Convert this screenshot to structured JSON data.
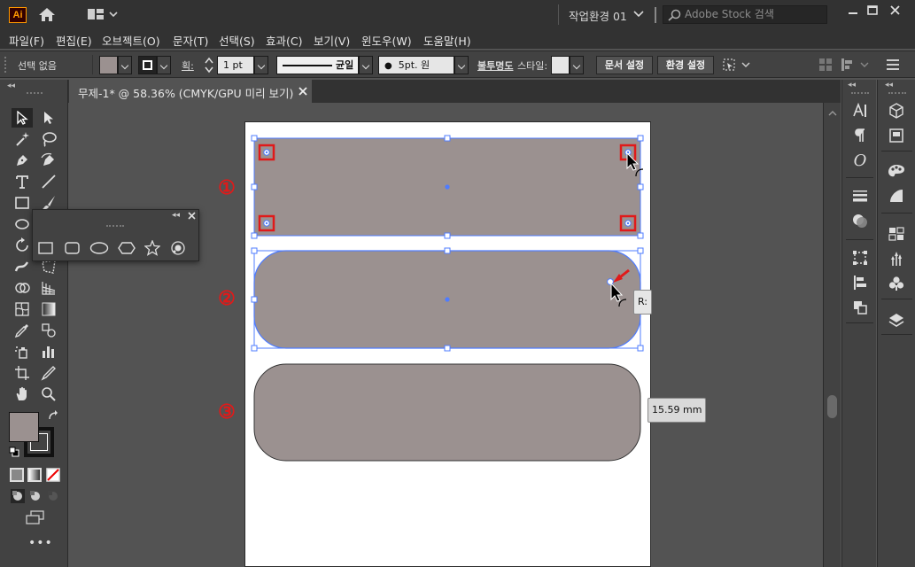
{
  "app": {
    "logo_text": "Ai",
    "workspace": "작업환경 01",
    "search_placeholder": "Adobe Stock 검색"
  },
  "menu": [
    "파일(F)",
    "편집(E)",
    "오브젝트(O)",
    "문자(T)",
    "선택(S)",
    "효과(C)",
    "보기(V)",
    "윈도우(W)",
    "도움말(H)"
  ],
  "control": {
    "selection_status": "선택 없음",
    "stroke_weight_label": "획:",
    "stroke_weight_value": "1 pt",
    "profile_label": "균일",
    "brush_label": "5pt. 원",
    "opacity_label": "불투명도",
    "style_label": "스타일:",
    "doc_setup_button": "문서 설정",
    "prefs_button": "환경 설정",
    "fill_color": "#9b9190",
    "style_swatch_color": "#e6e6e6"
  },
  "document": {
    "tab_title": "무제-1* @ 58.36% (CMYK/GPU 미리 보기)"
  },
  "artwork": {
    "shape_fill": "#9b9190",
    "shape_stroke": "#333333",
    "selection_color": "#4f7cff",
    "marker_color": "#e01a1a",
    "step_labels": [
      "①",
      "②",
      "③"
    ],
    "radius_tooltip": "R:",
    "size_tooltip": "15.59 mm"
  },
  "icons": {
    "toolbar": [
      "selection-tool-icon",
      "direct-selection-tool-icon",
      "magic-wand-tool-icon",
      "lasso-tool-icon",
      "pen-tool-icon",
      "curvature-tool-icon",
      "type-tool-icon",
      "line-segment-tool-icon",
      "rectangle-tool-icon",
      "paintbrush-tool-icon",
      "shaper-tool-icon",
      "eraser-tool-icon",
      "rotate-tool-icon",
      "scale-tool-icon",
      "warp-tool-icon",
      "free-transform-tool-icon",
      "shape-builder-tool-icon",
      "perspective-grid-tool-icon",
      "mesh-tool-icon",
      "gradient-tool-icon",
      "eyedropper-tool-icon",
      "blend-tool-icon",
      "symbol-sprayer-tool-icon",
      "column-graph-tool-icon",
      "artboard-tool-icon",
      "slice-tool-icon",
      "hand-tool-icon",
      "zoom-tool-icon"
    ],
    "shape_panel": [
      "rectangle-icon",
      "rounded-rectangle-icon",
      "ellipse-icon",
      "polygon-icon",
      "star-icon",
      "flare-icon"
    ]
  }
}
